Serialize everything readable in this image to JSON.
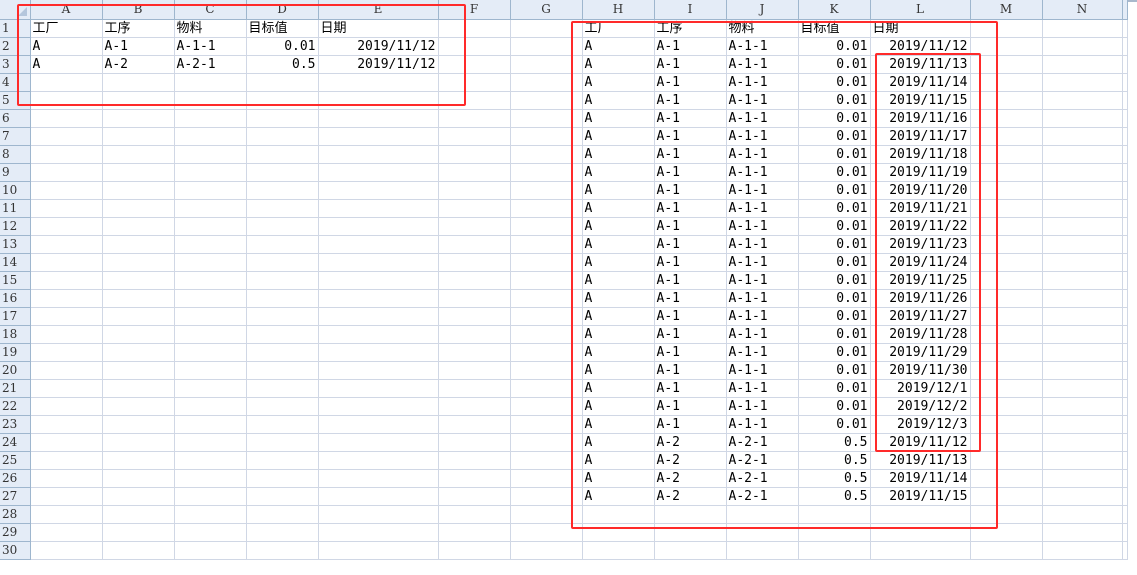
{
  "columns": [
    "A",
    "B",
    "C",
    "D",
    "E",
    "F",
    "G",
    "H",
    "I",
    "J",
    "K",
    "L",
    "M",
    "N"
  ],
  "header_row": [
    "工厂",
    "工序",
    "物料",
    "目标值",
    "日期"
  ],
  "source_rows": [
    [
      "A",
      "A-1",
      "A-1-1",
      "0.01",
      "2019/11/12"
    ],
    [
      "A",
      "A-2",
      "A-2-1",
      "0.5",
      "2019/11/12"
    ]
  ],
  "result_rows": [
    [
      "A",
      "A-1",
      "A-1-1",
      "0.01",
      "2019/11/12"
    ],
    [
      "A",
      "A-1",
      "A-1-1",
      "0.01",
      "2019/11/13"
    ],
    [
      "A",
      "A-1",
      "A-1-1",
      "0.01",
      "2019/11/14"
    ],
    [
      "A",
      "A-1",
      "A-1-1",
      "0.01",
      "2019/11/15"
    ],
    [
      "A",
      "A-1",
      "A-1-1",
      "0.01",
      "2019/11/16"
    ],
    [
      "A",
      "A-1",
      "A-1-1",
      "0.01",
      "2019/11/17"
    ],
    [
      "A",
      "A-1",
      "A-1-1",
      "0.01",
      "2019/11/18"
    ],
    [
      "A",
      "A-1",
      "A-1-1",
      "0.01",
      "2019/11/19"
    ],
    [
      "A",
      "A-1",
      "A-1-1",
      "0.01",
      "2019/11/20"
    ],
    [
      "A",
      "A-1",
      "A-1-1",
      "0.01",
      "2019/11/21"
    ],
    [
      "A",
      "A-1",
      "A-1-1",
      "0.01",
      "2019/11/22"
    ],
    [
      "A",
      "A-1",
      "A-1-1",
      "0.01",
      "2019/11/23"
    ],
    [
      "A",
      "A-1",
      "A-1-1",
      "0.01",
      "2019/11/24"
    ],
    [
      "A",
      "A-1",
      "A-1-1",
      "0.01",
      "2019/11/25"
    ],
    [
      "A",
      "A-1",
      "A-1-1",
      "0.01",
      "2019/11/26"
    ],
    [
      "A",
      "A-1",
      "A-1-1",
      "0.01",
      "2019/11/27"
    ],
    [
      "A",
      "A-1",
      "A-1-1",
      "0.01",
      "2019/11/28"
    ],
    [
      "A",
      "A-1",
      "A-1-1",
      "0.01",
      "2019/11/29"
    ],
    [
      "A",
      "A-1",
      "A-1-1",
      "0.01",
      "2019/11/30"
    ],
    [
      "A",
      "A-1",
      "A-1-1",
      "0.01",
      "2019/12/1"
    ],
    [
      "A",
      "A-1",
      "A-1-1",
      "0.01",
      "2019/12/2"
    ],
    [
      "A",
      "A-1",
      "A-1-1",
      "0.01",
      "2019/12/3"
    ],
    [
      "A",
      "A-2",
      "A-2-1",
      "0.5",
      "2019/11/12"
    ],
    [
      "A",
      "A-2",
      "A-2-1",
      "0.5",
      "2019/11/13"
    ],
    [
      "A",
      "A-2",
      "A-2-1",
      "0.5",
      "2019/11/14"
    ],
    [
      "A",
      "A-2",
      "A-2-1",
      "0.5",
      "2019/11/15"
    ]
  ],
  "total_rows": 30,
  "highlight_color": "#ff2a2a"
}
